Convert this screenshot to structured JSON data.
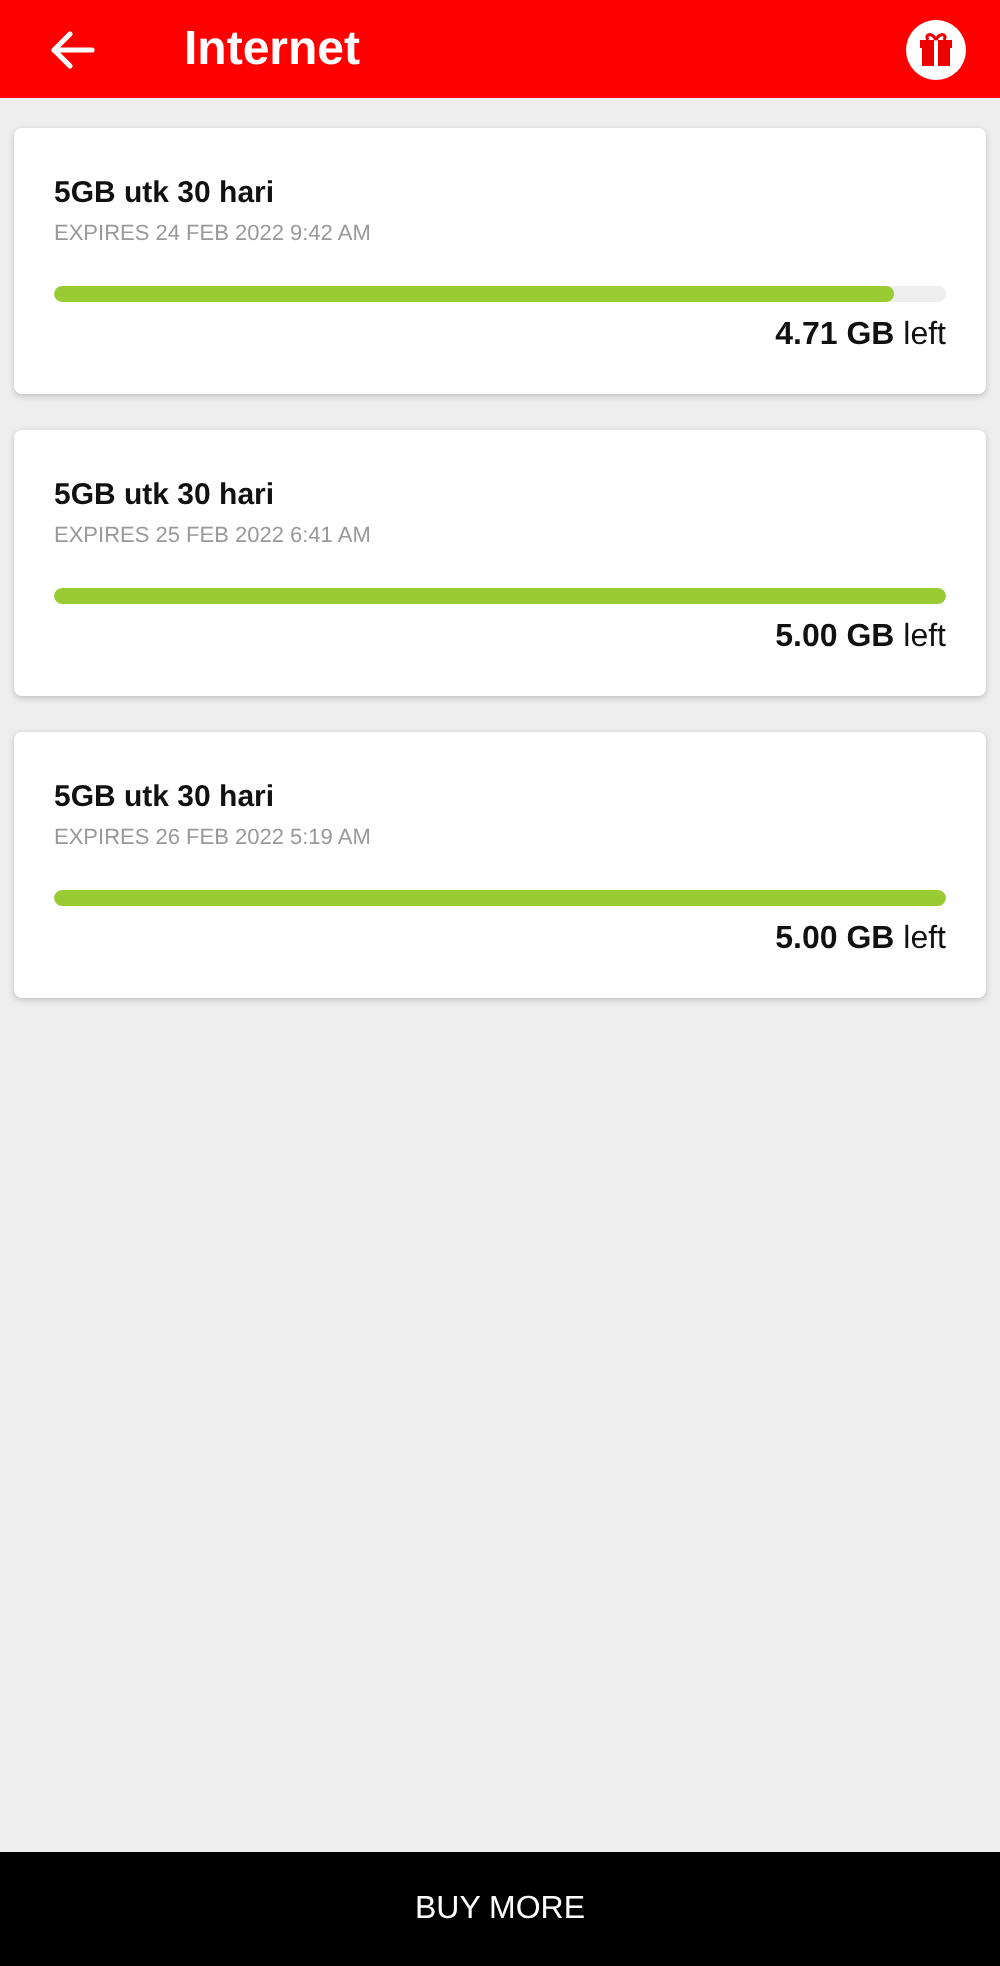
{
  "header": {
    "title": "Internet"
  },
  "plans": [
    {
      "name": "5GB utk 30 hari",
      "expires": "EXPIRES 24 FEB 2022 9:42 AM",
      "level": 0.942,
      "remaining": "**4.71 GB** left"
    },
    {
      "name": "5GB utk 30 hari",
      "expires": "EXPIRES 25 FEB 2022 6:41 AM",
      "level": 1,
      "remaining": "**5.00 GB** left"
    },
    {
      "name": "5GB utk 30 hari",
      "expires": "EXPIRES 26 FEB 2022 5:19 AM",
      "level": 1,
      "remaining": "**5.00 GB** left"
    }
  ],
  "footer": {
    "button": "BUY MORE"
  }
}
